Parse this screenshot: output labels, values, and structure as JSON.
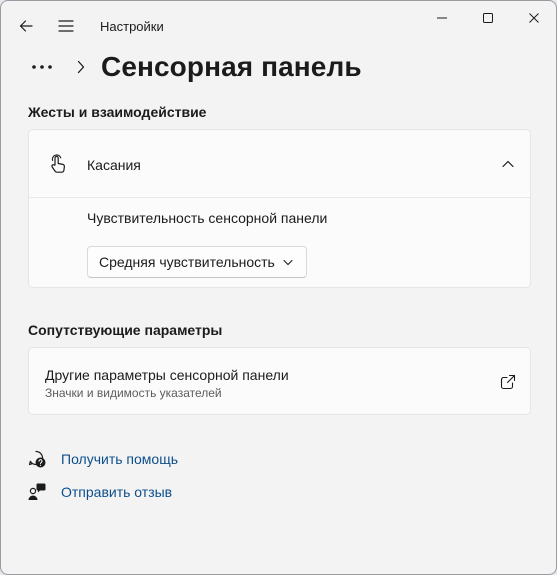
{
  "titlebar": {
    "app_title": "Настройки",
    "icons": {
      "back": "arrow-left-icon",
      "menu": "hamburger-menu-icon",
      "minimize": "minimize-icon",
      "maximize": "maximize-icon",
      "close": "close-icon"
    }
  },
  "header": {
    "more_icon": "more-horizontal-icon",
    "chevron_icon": "chevron-right-icon",
    "title": "Сенсорная панель"
  },
  "gestures_section": {
    "header": "Жесты и взаимодействие",
    "taps": {
      "icon": "tap-gesture-icon",
      "label": "Касания",
      "expanded": true,
      "sensitivity_label": "Чувствительность сенсорной панели",
      "sensitivity_value": "Средняя чувствительность"
    }
  },
  "related_section": {
    "header": "Сопутствующие параметры",
    "more_settings": {
      "title": "Другие параметры сенсорной панели",
      "subtitle": "Значки и видимость указателей",
      "icon": "open-external-icon"
    }
  },
  "footer": {
    "help_label": "Получить помощь",
    "feedback_label": "Отправить отзыв"
  },
  "colors": {
    "window_bg": "#f3f3f3",
    "card_bg": "#fbfbfb",
    "link": "#0d4f8b",
    "text": "#1b1b1b",
    "secondary_text": "#5d5d5d"
  }
}
